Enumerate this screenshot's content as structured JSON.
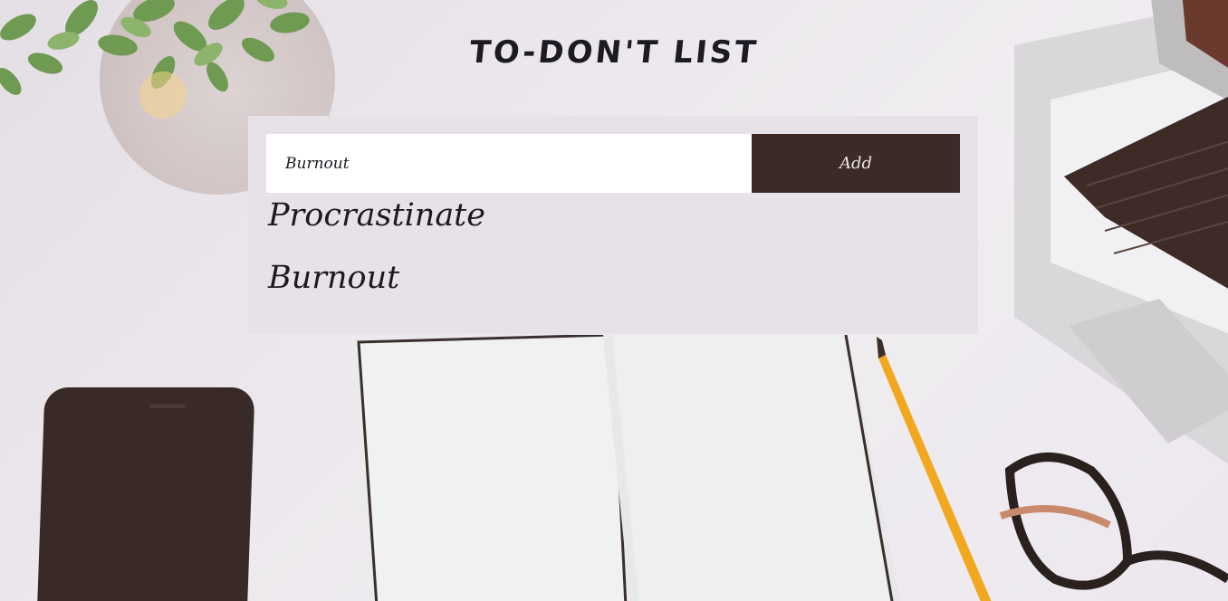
{
  "page": {
    "title": "TO-DON'T LIST"
  },
  "form": {
    "input_value": "Burnout",
    "add_label": "Add"
  },
  "items": [
    {
      "label": "Procrastinate"
    },
    {
      "label": "Burnout"
    }
  ],
  "colors": {
    "panel": "#e7e2e7",
    "button": "#3c2a27",
    "text": "#1c1a22"
  },
  "background_icons": [
    "plant-icon",
    "laptop-icon",
    "phone-icon",
    "notebook-icon",
    "pencil-icon",
    "glasses-icon"
  ]
}
